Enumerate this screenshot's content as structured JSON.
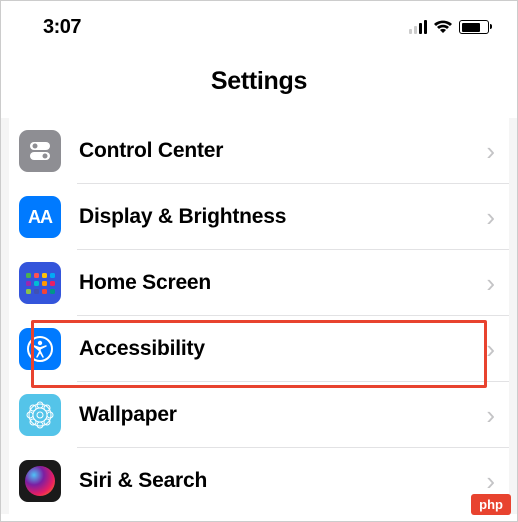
{
  "status": {
    "time": "3:07"
  },
  "header": {
    "title": "Settings"
  },
  "rows": {
    "control": "Control Center",
    "display": "Display & Brightness",
    "home": "Home Screen",
    "access": "Accessibility",
    "wall": "Wallpaper",
    "siri": "Siri & Search"
  },
  "watermark": "php"
}
